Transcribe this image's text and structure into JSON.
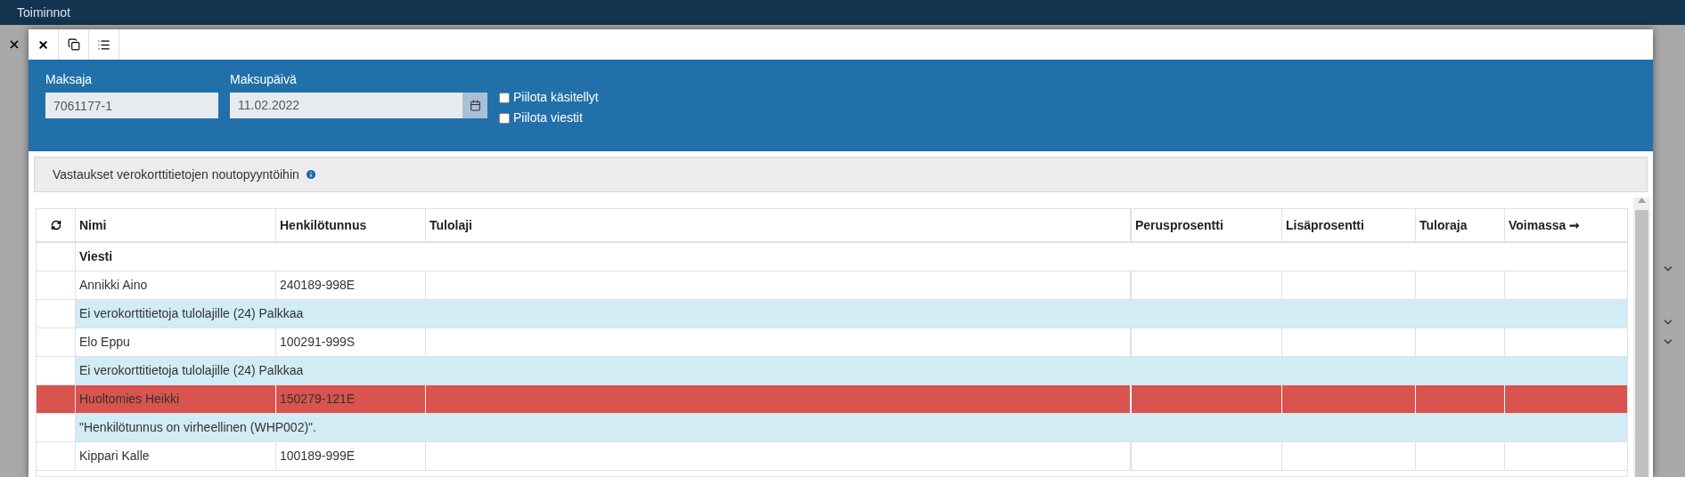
{
  "app_bar": {
    "title": "Toiminnot"
  },
  "filters": {
    "payer": {
      "label": "Maksaja",
      "value": "7061177-1"
    },
    "pay_date": {
      "label": "Maksupäivä",
      "value": "11.02.2022"
    },
    "checkboxes": [
      {
        "label": "Piilota käsitellyt",
        "checked": false
      },
      {
        "label": "Piilota viestit",
        "checked": false
      }
    ]
  },
  "info_panel": {
    "title": "Vastaukset verokorttitietojen noutopyyntöihin"
  },
  "table": {
    "columns": [
      "Nimi",
      "Henkilötunnus",
      "Tulolaji",
      "Perusprosentti",
      "Lisäprosentti",
      "Tuloraja",
      "Voimassa ➞"
    ],
    "rows": [
      {
        "kind": "group",
        "text": "Viesti"
      },
      {
        "kind": "person",
        "name": "Annikki Aino",
        "id": "240189-998E",
        "error": false
      },
      {
        "kind": "message",
        "text": "Ei verokorttitietoja tulolajille (24) Palkkaa"
      },
      {
        "kind": "person",
        "name": "Elo Eppu",
        "id": "100291-999S",
        "error": false
      },
      {
        "kind": "message",
        "text": "Ei verokorttitietoja tulolajille (24) Palkkaa"
      },
      {
        "kind": "person",
        "name": "Huoltomies Heikki",
        "id": "150279-121E",
        "error": true
      },
      {
        "kind": "message",
        "text": "\"Henkilötunnus on virheellinen (WHP002)\"."
      },
      {
        "kind": "person",
        "name": "Kippari Kalle",
        "id": "100189-999E",
        "error": false
      }
    ]
  }
}
